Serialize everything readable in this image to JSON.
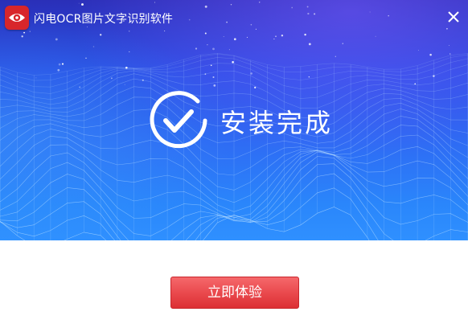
{
  "window": {
    "title": "闪电OCR图片文字识别软件",
    "logo_icon": "eye-logo-icon",
    "close_icon": "close-icon"
  },
  "status": {
    "icon": "check-circle-icon",
    "text": "安装完成"
  },
  "actions": {
    "primary_label": "立即体验"
  },
  "colors": {
    "hero_top": "#2a2fb8",
    "hero_bottom": "#2f90ff",
    "logo_red": "#d8262b",
    "button_red": "#ea4a4e",
    "text_white": "#ffffff"
  }
}
